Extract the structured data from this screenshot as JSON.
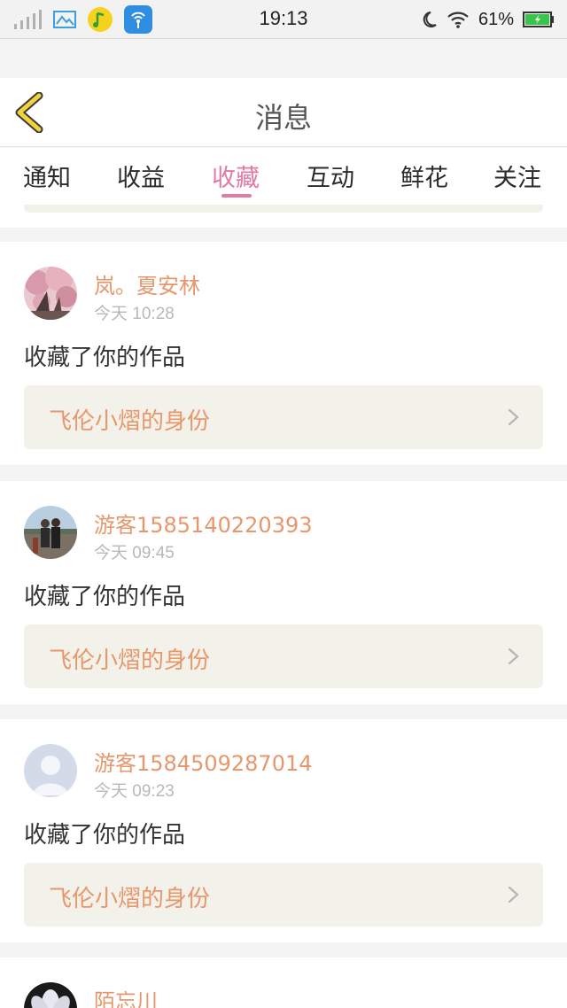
{
  "status_bar": {
    "time": "19:13",
    "battery": "61%",
    "icons": [
      "signal-icon",
      "gallery-icon",
      "music-app-icon",
      "wifi-app-icon",
      "do-not-disturb-icon",
      "wifi-icon",
      "battery-icon"
    ]
  },
  "header": {
    "title": "消息",
    "back_icon": "chevron-left-icon"
  },
  "tabs": [
    {
      "label": "通知"
    },
    {
      "label": "收益"
    },
    {
      "label": "收藏",
      "active": true
    },
    {
      "label": "互动"
    },
    {
      "label": "鲜花"
    },
    {
      "label": "关注"
    }
  ],
  "colors": {
    "accent_pink": "#e27aa5",
    "name_orange": "#e7976b",
    "back_yellow": "#f2d33a",
    "card_box": "#f3f2ea"
  },
  "messages": [
    {
      "user": "岚。夏安林",
      "time": "今天 10:28",
      "action": "收藏了你的作品",
      "work": "飞伦小熠的身份",
      "avatar": "cherry-blossom-avatar"
    },
    {
      "user": "游客1585140220393",
      "time": "今天 09:45",
      "action": "收藏了你的作品",
      "work": "飞伦小熠的身份",
      "avatar": "couple-photo-avatar"
    },
    {
      "user": "游客1584509287014",
      "time": "今天 09:23",
      "action": "收藏了你的作品",
      "work": "飞伦小熠的身份",
      "avatar": "default-user-avatar"
    },
    {
      "user": "陌忘川",
      "avatar": "flower-avatar"
    }
  ]
}
